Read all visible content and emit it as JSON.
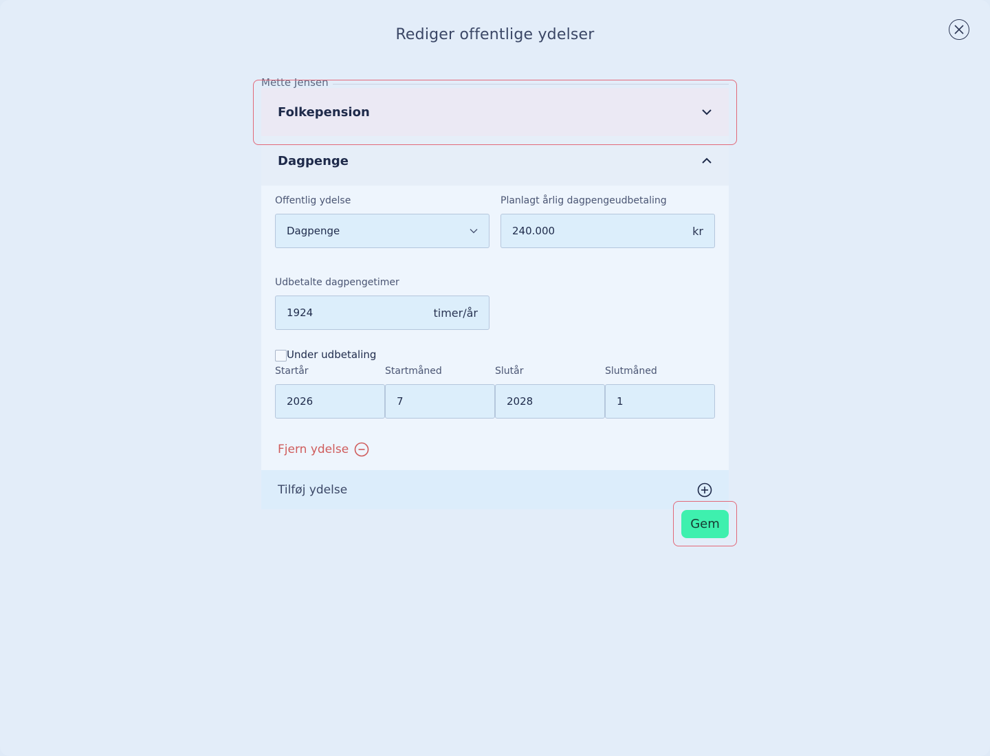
{
  "modal": {
    "title": "Rediger offentlige ydelser"
  },
  "person": {
    "name": "Mette Jensen"
  },
  "accordions": [
    {
      "label": "Folkepension",
      "expanded": false
    },
    {
      "label": "Dagpenge",
      "expanded": true
    }
  ],
  "form": {
    "benefit_type_label": "Offentlig ydelse",
    "benefit_type_value": "Dagpenge",
    "annual_payout_label": "Planlagt årlig dagpengeudbetaling",
    "annual_payout_value": "240.000",
    "annual_payout_unit": "kr",
    "hours_label": "Udbetalte dagpengetimer",
    "hours_value": "1924",
    "hours_unit": "timer/år",
    "under_payout_label": "Under udbetaling",
    "under_payout_checked": false,
    "start_year_label": "Startår",
    "start_year_value": "2026",
    "start_month_label": "Startmåned",
    "start_month_value": "7",
    "end_year_label": "Slutår",
    "end_year_value": "2028",
    "end_month_label": "Slutmåned",
    "end_month_value": "1",
    "remove_label": "Fjern ydelse"
  },
  "add_benefit": {
    "label": "Tilføj ydelse"
  },
  "actions": {
    "save_label": "Gem"
  },
  "icons": {
    "close": "close-circle-icon",
    "collapsed": "chevron-down-icon",
    "expanded": "chevron-up-icon",
    "select": "chevron-down-icon",
    "remove": "minus-circle-icon",
    "add": "plus-circle-icon"
  },
  "colors": {
    "background": "#e3edf9",
    "accent_save": "#3ef0ae",
    "danger": "#cf5b5b",
    "focus_ring": "#e26878"
  }
}
